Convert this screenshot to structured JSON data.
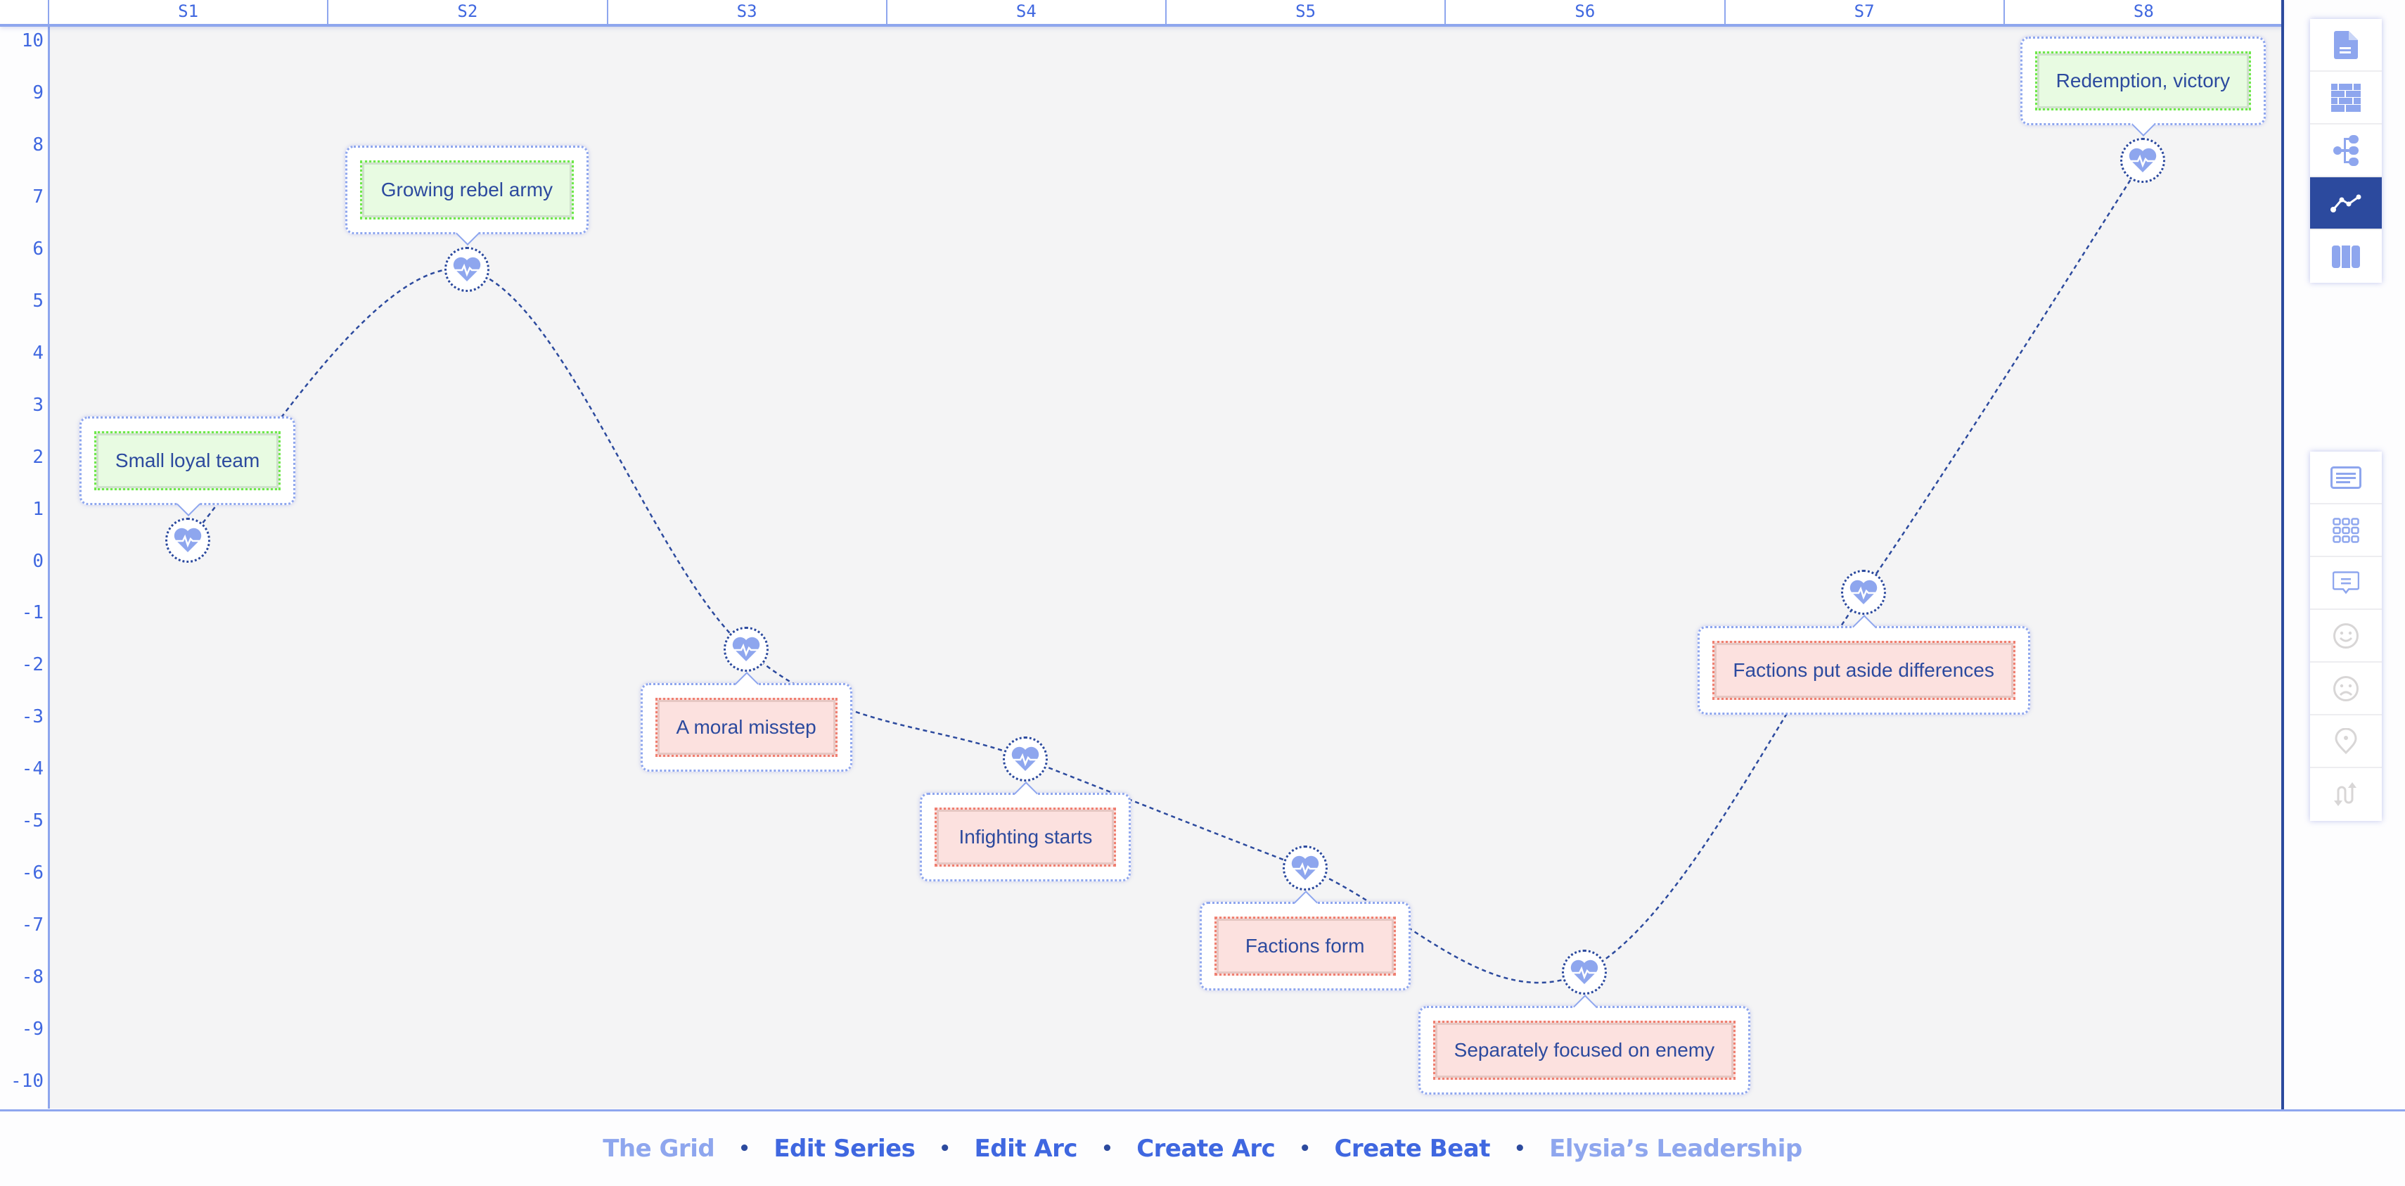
{
  "colors": {
    "accent": "#3f67e0",
    "accent_light": "#8ea6ee",
    "dark": "#2c4a9e",
    "positive_fill": "#e8fbe2",
    "positive_border": "#6ee84a",
    "negative_fill": "#fce1df",
    "negative_border": "#ef7f70",
    "plot_bg": "#f4f4f5"
  },
  "chart_data": {
    "type": "line",
    "title": "",
    "xlabel": "",
    "ylabel": "",
    "categories": [
      "S1",
      "S2",
      "S3",
      "S4",
      "S5",
      "S6",
      "S7",
      "S8"
    ],
    "ylim": [
      -10,
      10
    ],
    "yticks": [
      "10",
      "9",
      "8",
      "7",
      "6",
      "5",
      "4",
      "3",
      "2",
      "1",
      "0",
      "-1",
      "-2",
      "-3",
      "-4",
      "-5",
      "-6",
      "-7",
      "-8",
      "-9",
      "-10"
    ],
    "grid": false,
    "curve_style": "dotted smooth spline",
    "series": [
      {
        "name": "Elysia's Leadership",
        "values": [
          0.4,
          5.6,
          -1.7,
          -3.8,
          -5.9,
          -7.9,
          -0.6,
          7.7
        ]
      }
    ],
    "annotations": [
      {
        "category": "S1",
        "label": "Small loyal team",
        "tone": "positive",
        "placement": "above"
      },
      {
        "category": "S2",
        "label": "Growing rebel army",
        "tone": "positive",
        "placement": "above"
      },
      {
        "category": "S3",
        "label": "A moral misstep",
        "tone": "negative",
        "placement": "below"
      },
      {
        "category": "S4",
        "label": "Infighting starts",
        "tone": "negative",
        "placement": "below"
      },
      {
        "category": "S5",
        "label": "Factions form",
        "tone": "negative",
        "placement": "below"
      },
      {
        "category": "S6",
        "label": "Separately focused on enemy",
        "tone": "negative",
        "placement": "below"
      },
      {
        "category": "S7",
        "label": "Factions put aside differences",
        "tone": "negative",
        "placement": "below"
      },
      {
        "category": "S8",
        "label": "Redemption, victory",
        "tone": "positive",
        "placement": "above"
      }
    ]
  },
  "toolbar_top": [
    {
      "icon": "document-icon",
      "active": false
    },
    {
      "icon": "brick-wall-icon",
      "active": false
    },
    {
      "icon": "hierarchy-icon",
      "active": false
    },
    {
      "icon": "line-chart-icon",
      "active": true
    },
    {
      "icon": "columns-icon",
      "active": false
    }
  ],
  "toolbar_bottom": [
    {
      "icon": "text-block-icon",
      "enabled": true
    },
    {
      "icon": "grid-icon",
      "enabled": true
    },
    {
      "icon": "comment-icon",
      "enabled": true
    },
    {
      "icon": "smile-icon",
      "enabled": false
    },
    {
      "icon": "frown-icon",
      "enabled": false
    },
    {
      "icon": "location-pin-icon",
      "enabled": false
    },
    {
      "icon": "swap-arrows-icon",
      "enabled": false
    }
  ],
  "footer": {
    "separator": "•",
    "items": [
      {
        "label": "The Grid",
        "muted": true
      },
      {
        "label": "Edit Series",
        "muted": false
      },
      {
        "label": "Edit Arc",
        "muted": false
      },
      {
        "label": "Create Arc",
        "muted": false
      },
      {
        "label": "Create Beat",
        "muted": false
      },
      {
        "label": "Elysia’s Leadership",
        "muted": true
      }
    ]
  }
}
